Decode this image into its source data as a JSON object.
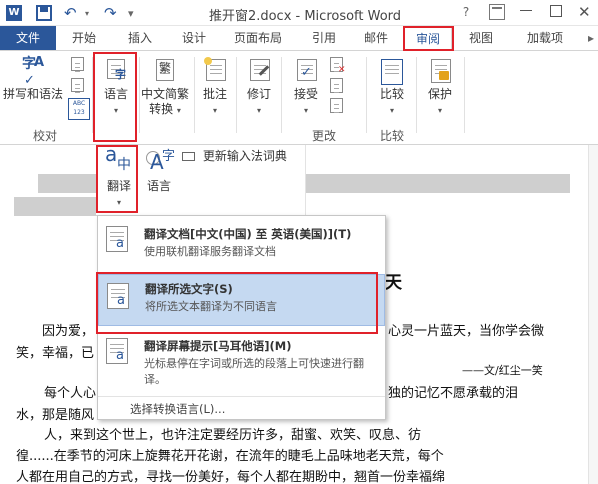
{
  "titlebar": {
    "app_badge": "W",
    "title": "推开窗2.docx - Microsoft Word",
    "help": "?",
    "close": "✕",
    "undo_glyph": "↶",
    "redo_glyph": "↷",
    "dropdown_glyph": "▾",
    "more_glyph": "▾"
  },
  "tabs": {
    "file": "文件",
    "home": "开始",
    "insert": "插入",
    "design": "设计",
    "layout": "页面布局",
    "references": "引用",
    "mailings": "邮件",
    "review": "审阅",
    "view": "视图",
    "addins": "加载项",
    "more": "▸"
  },
  "ribbon": {
    "spelling_label": "拼写和语法",
    "proofing_group": "校对",
    "language_label": "语言",
    "chinese_conversion_line1": "中文简繁",
    "chinese_conversion_line2": "转换",
    "comments_label": "批注",
    "track_label": "修订",
    "accept_label": "接受",
    "changes_group": "更改",
    "compare_label": "比较",
    "compare_group": "比较",
    "protect_label": "保护",
    "caret": "▾",
    "stat_glyph": "ABC",
    "stat_num": "123",
    "fan_glyph": "繁"
  },
  "language_panel": {
    "translate_label": "翻译",
    "language_label": "语言",
    "update_ime_label": "更新输入法词典",
    "translate_glyph_a": "a",
    "translate_glyph_zh": "中",
    "language_glyph_a": "A",
    "language_glyph_zh": "字"
  },
  "dropdown": {
    "items": [
      {
        "title": "翻译文档[中文(中国) 至 英语(美国)](T)",
        "desc": "使用联机翻译服务翻译文档"
      },
      {
        "title": "翻译所选文字(S)",
        "desc": "将所选文本翻译为不同语言"
      },
      {
        "title": "翻译屏幕提示[马耳他语](M)",
        "desc": "光标悬停在字词或所选的段落上可快速进行翻译。"
      }
    ],
    "choose_language": "选择转换语言(L)..."
  },
  "document": {
    "title_fragment": "天",
    "line1_left": "因为爱，",
    "line1_right": "心灵一片蓝天，当你学会微",
    "line2": "笑，幸福，已",
    "byline": "——文/红尘一笑",
    "para1_line1_left": "每个人心",
    "para1_line1_right": "独的记忆不愿承载的泪",
    "para1_line2": "水，那是随风",
    "para2_line1": "人，来到这个世上，也许注定要经历许多，甜蜜、欢笑、叹息、彷",
    "para2_line2": "徨......在季节的河床上旋舞花开花谢，在流年的睫毛上品味地老天荒，每个",
    "para2_line3": "人都在用自己的方式，寻找一份美好，每个人都在期盼中，翘首一份幸福绵"
  }
}
